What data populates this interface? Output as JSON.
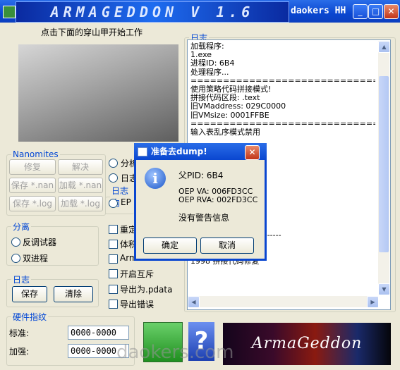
{
  "window": {
    "banner": "ARMAGEDDON V 1.6",
    "title": "daokers HH"
  },
  "armadillo_caption": "点击下面的穿山甲开始工作",
  "nanomites": {
    "legend": "Nanomites",
    "buttons": [
      "修复",
      "解决",
      "保存 *.nan",
      "加载 *.nan",
      "保存 *.log",
      "加载 *.log"
    ]
  },
  "middle_radios": [
    "分析",
    "日志",
    "EP"
  ],
  "middle_legend_fragment": "日志内",
  "separation": {
    "legend": "分离",
    "options": [
      "反调试器",
      "双进程"
    ]
  },
  "checks": [
    "重定",
    "体积",
    "Arm",
    "开启互斥",
    "导出为.pdata",
    "导出错误"
  ],
  "log_group": {
    "legend": "日志",
    "save": "保存",
    "clear": "清除"
  },
  "hardware": {
    "legend": "硬件指纹",
    "std_label": "标准:",
    "std_value": "0000-0000",
    "enh_label": "加强:",
    "enh_value": "0000-0000"
  },
  "log_panel": {
    "legend": "日志",
    "text": "加载程序:\n1.exe\n进程ID: 6B4\n处理程序...\n================================\n使用策略代码拼接模式!\n拼接代码区段: .text\n旧VMaddress: 029C0000\n旧VMsize: 0001FFBE\n================================\n输入表乱序模式禁用\n\n\n               用!\n               data1\n               5008\n               5000\n\n               式禁用\n\n\n\n------- 代码拼接模式 -------\n进程内存缓冲成功\n修复拼接代码段\n1998 拼接代码修复"
  },
  "dialog": {
    "title": "准备去dump!",
    "pid": "父PID: 6B4",
    "oep_va": "OEP VA: 006FD3CC",
    "oep_rva": "OEP RVA: 002FD3CC",
    "warn": "没有警告信息",
    "ok": "确定",
    "cancel": "取消"
  },
  "logo_text": "ArmaGeddon",
  "help_glyph": "?",
  "watermark": "daokers.com"
}
